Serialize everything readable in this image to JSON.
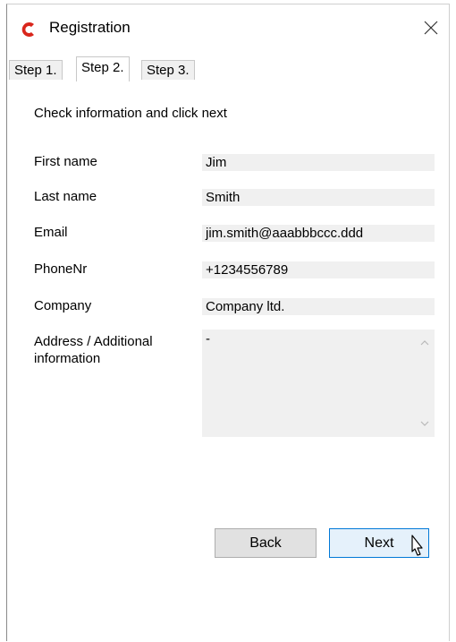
{
  "window": {
    "title": "Registration"
  },
  "tabs": [
    {
      "label": "Step 1."
    },
    {
      "label": "Step 2."
    },
    {
      "label": "Step 3."
    }
  ],
  "form": {
    "instruction": "Check information and click next",
    "first_name": {
      "label": "First name",
      "value": "Jim"
    },
    "last_name": {
      "label": "Last name",
      "value": "Smith"
    },
    "email": {
      "label": "Email",
      "value": "jim.smith@aaabbbccc.ddd"
    },
    "phone": {
      "label": "PhoneNr",
      "value": "+1234556789"
    },
    "company": {
      "label": "Company",
      "value": "Company ltd."
    },
    "address": {
      "label_line1": "Address / Additional",
      "label_line2": "information",
      "value": "-"
    }
  },
  "buttons": {
    "back": "Back",
    "next": "Next"
  },
  "icons": {
    "app": "red-c-logo-icon",
    "close": "close-icon",
    "cursor": "mouse-pointer-icon"
  },
  "colors": {
    "brand": "#d9261c",
    "field_bg": "#f0f0f0",
    "next_border": "#0078d7"
  }
}
